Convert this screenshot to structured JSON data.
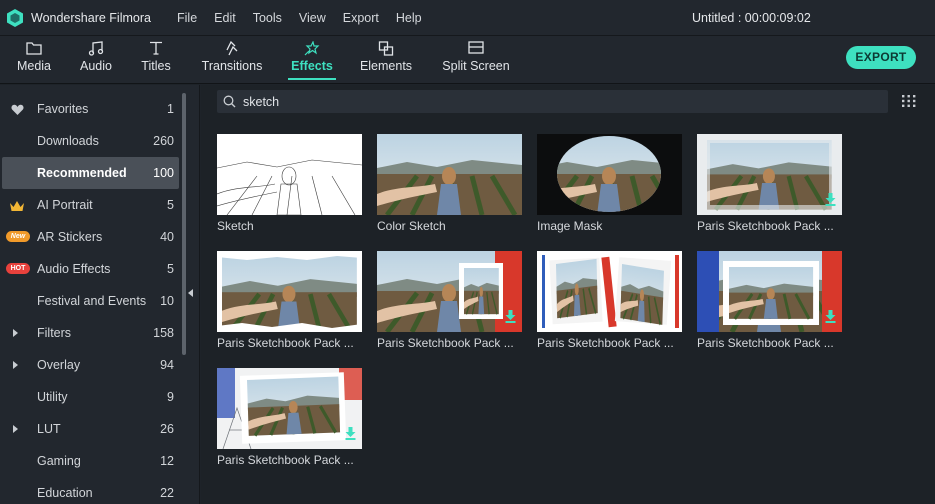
{
  "app": {
    "name": "Wondershare Filmora",
    "project_title": "Untitled : 00:00:09:02",
    "accent": "#3ee0c0"
  },
  "menu": [
    "File",
    "Edit",
    "Tools",
    "View",
    "Export",
    "Help"
  ],
  "toolbar": {
    "tabs": [
      {
        "label": "Media",
        "icon": "folder-icon"
      },
      {
        "label": "Audio",
        "icon": "music-note-icon"
      },
      {
        "label": "Titles",
        "icon": "text-t-icon"
      },
      {
        "label": "Transitions",
        "icon": "transition-icon"
      },
      {
        "label": "Effects",
        "icon": "sparkle-icon",
        "active": true
      },
      {
        "label": "Elements",
        "icon": "elements-icon"
      },
      {
        "label": "Split Screen",
        "icon": "split-screen-icon"
      }
    ],
    "export_label": "EXPORT"
  },
  "sidebar": {
    "items": [
      {
        "label": "Favorites",
        "count": "1",
        "icon": "heart-icon"
      },
      {
        "label": "Downloads",
        "count": "260"
      },
      {
        "label": "Recommended",
        "count": "100",
        "selected": true
      },
      {
        "label": "AI Portrait",
        "count": "5",
        "icon": "crown-icon"
      },
      {
        "label": "AR Stickers",
        "count": "40",
        "badge": "New"
      },
      {
        "label": "Audio Effects",
        "count": "5",
        "badge": "HOT"
      },
      {
        "label": "Festival and Events",
        "count": "10"
      },
      {
        "label": "Filters",
        "count": "158",
        "expandable": true
      },
      {
        "label": "Overlay",
        "count": "94",
        "expandable": true
      },
      {
        "label": "Utility",
        "count": "9"
      },
      {
        "label": "LUT",
        "count": "26",
        "expandable": true
      },
      {
        "label": "Gaming",
        "count": "12"
      },
      {
        "label": "Education",
        "count": "22"
      }
    ]
  },
  "search": {
    "value": "sketch",
    "placeholder": "Search"
  },
  "effects": [
    {
      "label": "Sketch",
      "style": "sketch"
    },
    {
      "label": "Color Sketch",
      "style": "color"
    },
    {
      "label": "Image Mask",
      "style": "mask"
    },
    {
      "label": "Paris Sketchbook Pack ...",
      "style": "paris-wash",
      "download": true
    },
    {
      "label": "Paris Sketchbook Pack ...",
      "style": "paris-torn"
    },
    {
      "label": "Paris Sketchbook Pack ...",
      "style": "paris-frame-right",
      "download": true
    },
    {
      "label": "Paris Sketchbook Pack ...",
      "style": "paris-double"
    },
    {
      "label": "Paris Sketchbook Pack ...",
      "style": "paris-frame-flag",
      "download": true
    },
    {
      "label": "Paris Sketchbook Pack ...",
      "style": "paris-frame-sketch",
      "download": true
    }
  ]
}
